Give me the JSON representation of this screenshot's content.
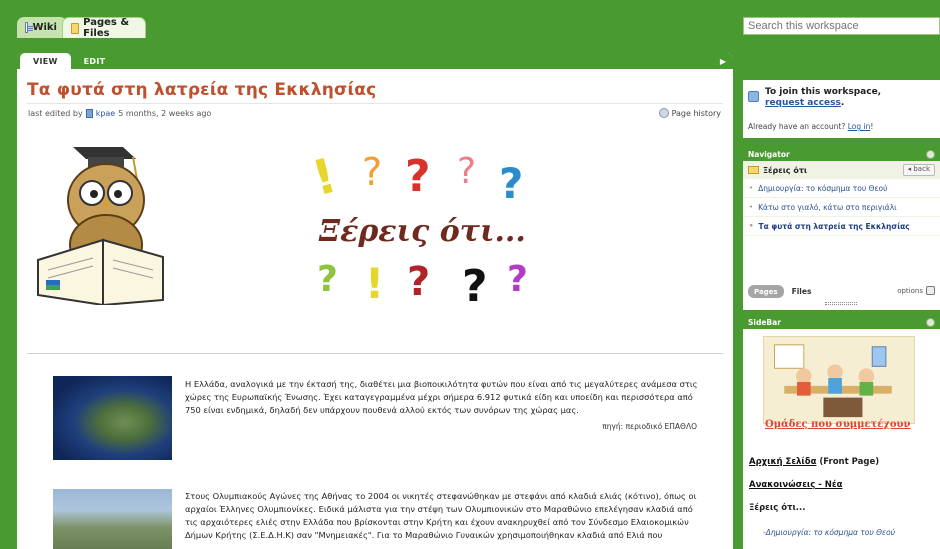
{
  "tabs": {
    "wiki": "Wiki",
    "pages": "Pages & Files"
  },
  "search": {
    "placeholder": "Search this workspace"
  },
  "view_tabs": {
    "view": "VIEW",
    "edit": "EDIT"
  },
  "page": {
    "title": "Τα φυτά στη λατρεία της Εκκλησίας",
    "last_edited_prefix": "last edited by",
    "user": "kpae",
    "last_edited_time": "5 months, 2 weeks ago",
    "page_history": "Page history",
    "banner_text": "Ξέρεις ότι...",
    "para1": "Η Ελλάδα, αναλογικά με την έκτασή της, διαθέτει μια βιοποικιλότητα φυτών που είναι από τις μεγαλύτερες ανάμεσα στις χώρες της Ευρωπαϊκής Ένωσης. Έχει καταγεγραμμένα μέχρι σήμερα 6.912 φυτικά είδη και υποείδη και περισσότερα από 750 είναι ενδημικά, δηλαδή δεν υπάρχουν πουθενά αλλού εκτός των συνόρων της χώρας μας.",
    "source": "πηγή: περιοδικό ΕΠΑΘΛΟ",
    "para2": "Στους Ολυμπιακούς Αγώνες της Αθήνας το 2004 οι νικητές στεφανώθηκαν με στεφάνι από κλαδιά ελιάς (κότινο), όπως οι αρχαίοι Έλληνες Ολυμπιονίκες. Ειδικά μάλιστα για την στέψη των Ολυμπιονικών στο Μαραθώνιο επελέγησαν κλαδιά από τις αρχαιότερες ελιές στην Ελλάδα που βρίσκονται στην Κρήτη και έχουν ανακηρυχθεί από τον Σύνδεσμο Ελαιοκομικών Δήμων Κρήτης (Σ.Ε.Δ.Η.Κ) σαν \"Μνημειακές\". Για το Μαραθώνιο Γυναικών χρησιμοποιήθηκαν κλαδιά από Ελιά που"
  },
  "join": {
    "text_before": "To join this workspace,",
    "link": "request access",
    "text_after": ".",
    "already": "Already have an account?",
    "login": "Log in"
  },
  "navigator": {
    "heading": "Navigator",
    "folder": "Ξέρεις ότι",
    "back": "back",
    "items": [
      "Δημιουργία: το κόσμημα του Θεού",
      "Κάτω στο γιαλό, κάτω στο περιγιάλι",
      "Τα φυτά στη λατρεία της Εκκλησίας"
    ],
    "tab_pages": "Pages",
    "tab_files": "Files",
    "options": "options"
  },
  "sidebar": {
    "heading": "SideBar",
    "groups_link": "Ομάδες που συμμετέχουν",
    "front_page_link": "Αρχική Σελίδα",
    "front_page_suffix": " (Front Page)",
    "news_link": "Ανακοινώσεις - Νέα",
    "did_you_know": "Ξέρεις ότι...",
    "sub_item": "-Δημιουργία: το κόσμημα του Θεού"
  },
  "colors": {
    "accent_green": "#4a9a32",
    "title_orange": "#c0502d"
  }
}
